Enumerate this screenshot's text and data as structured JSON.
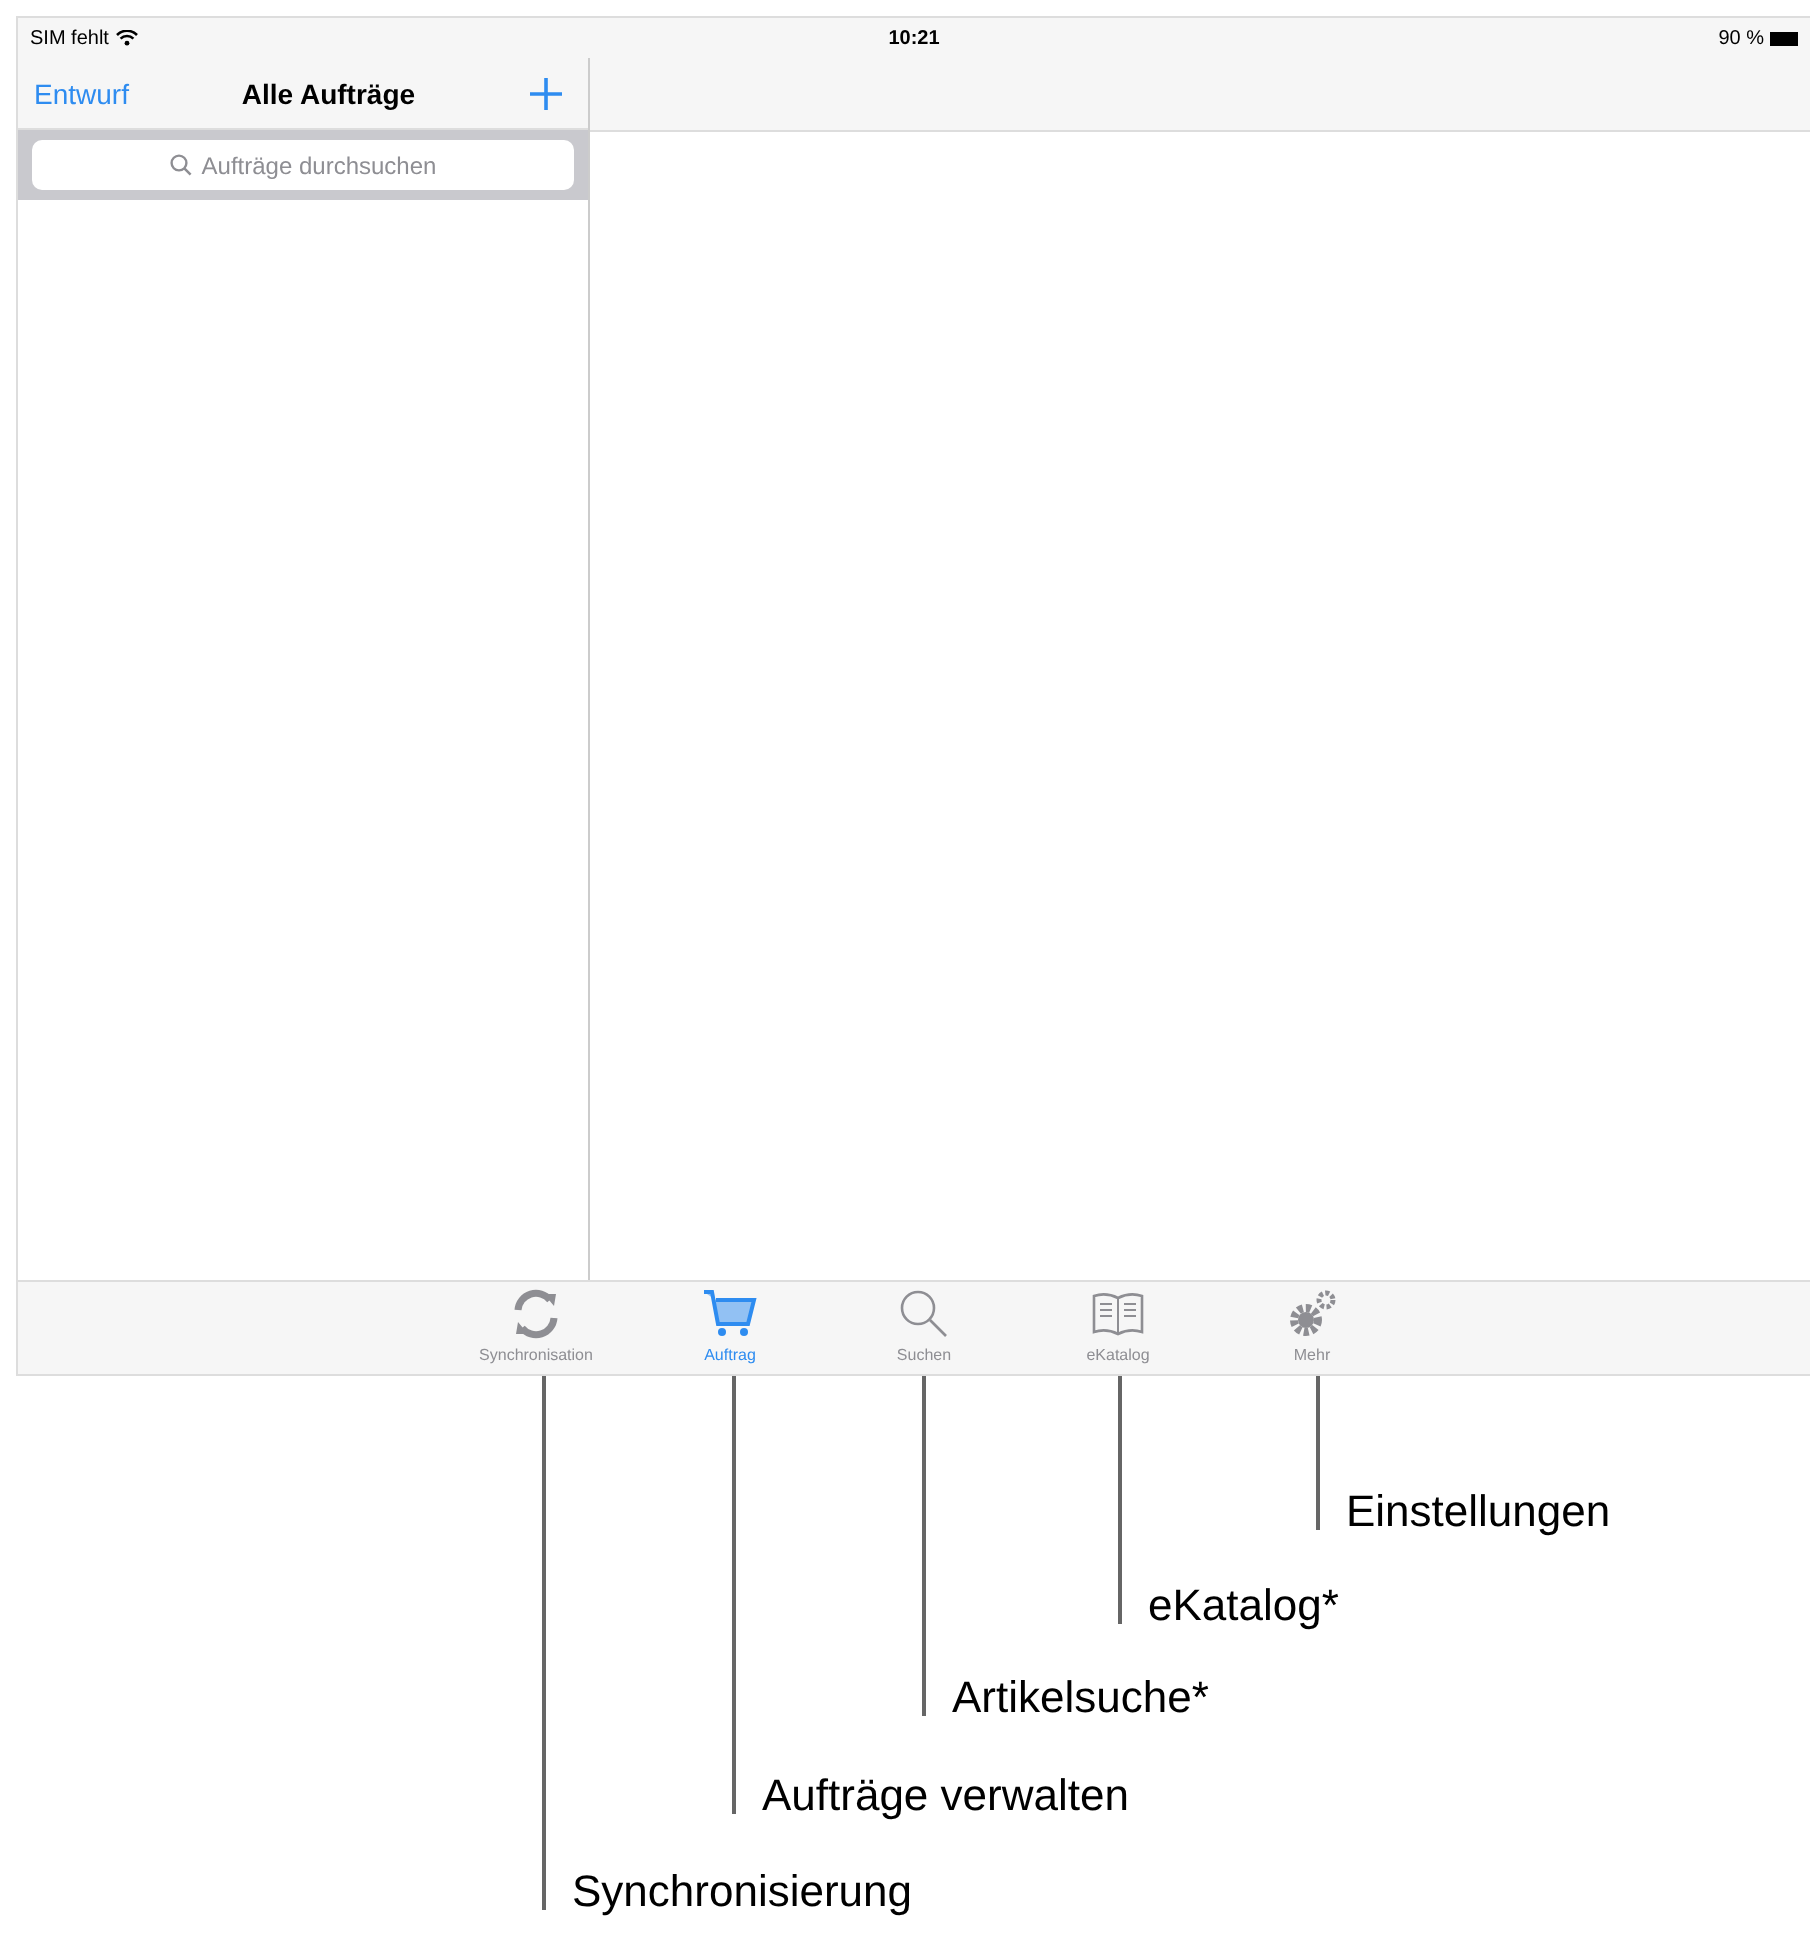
{
  "status_bar": {
    "carrier": "SIM fehlt",
    "time": "10:21",
    "battery": "90 %"
  },
  "nav_bar": {
    "left_button": "Entwurf",
    "title": "Alle Aufträge"
  },
  "search": {
    "placeholder": "Aufträge durchsuchen"
  },
  "tabs": [
    {
      "kind": "sync",
      "label": "Synchronisation",
      "selected": false
    },
    {
      "kind": "cart",
      "label": "Auftrag",
      "selected": true
    },
    {
      "kind": "search",
      "label": "Suchen",
      "selected": false
    },
    {
      "kind": "book",
      "label": "eKatalog",
      "selected": false
    },
    {
      "kind": "gears",
      "label": "Mehr",
      "selected": false
    }
  ],
  "callouts": [
    {
      "label": "Einstellungen"
    },
    {
      "label": "eKatalog*"
    },
    {
      "label": "Artikelsuche*"
    },
    {
      "label": "Aufträge verwalten"
    },
    {
      "label": "Synchronisierung"
    }
  ]
}
